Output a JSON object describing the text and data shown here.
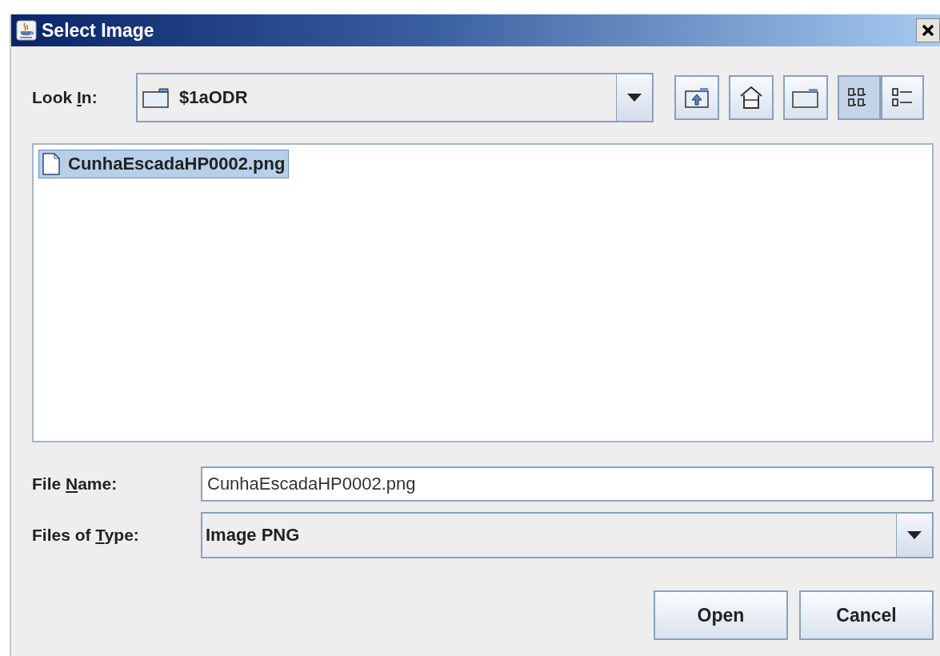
{
  "window": {
    "title": "Select Image"
  },
  "look_in": {
    "label": [
      {
        "text": "Look ",
        "underlined": false
      },
      {
        "text": "I",
        "underlined": true
      },
      {
        "text": "n:",
        "underlined": false
      }
    ],
    "value": "$1aODR"
  },
  "toolbar": [
    {
      "kind": "up"
    },
    {
      "kind": "home"
    },
    {
      "kind": "new-folder"
    },
    {
      "kind": "list",
      "selected": true
    },
    {
      "kind": "details",
      "selected": false
    }
  ],
  "files": [
    {
      "name": "CunhaEscadaHP0002.png",
      "selected": true
    }
  ],
  "file_name": {
    "label": [
      {
        "text": "File ",
        "underlined": false
      },
      {
        "text": "N",
        "underlined": true
      },
      {
        "text": "ame:",
        "underlined": false
      }
    ],
    "value": "CunhaEscadaHP0002.png"
  },
  "file_type": {
    "label": [
      {
        "text": "Files of ",
        "underlined": false
      },
      {
        "text": "T",
        "underlined": true
      },
      {
        "text": "ype:",
        "underlined": false
      }
    ],
    "value": "Image PNG"
  },
  "buttons": [
    "Open",
    "Cancel"
  ]
}
